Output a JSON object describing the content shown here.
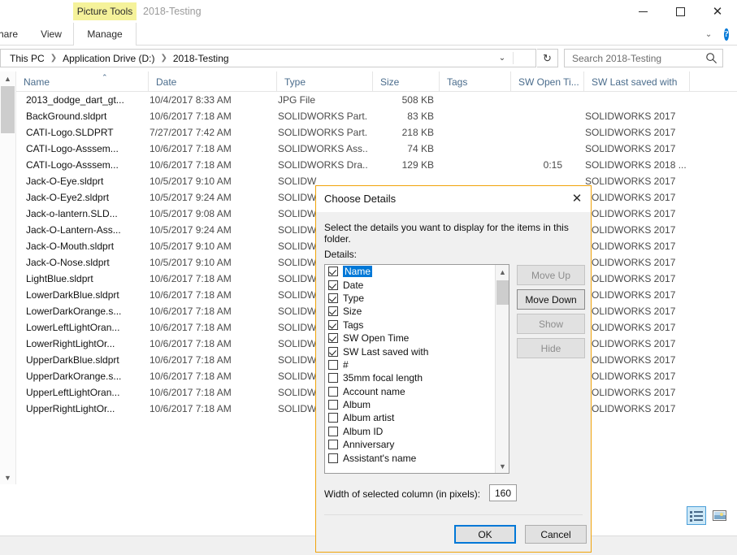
{
  "window": {
    "context_tab": "Picture Tools",
    "title": "2018-Testing",
    "minimize_label": "—",
    "maximize_label": "",
    "close_label": "✕"
  },
  "ribbon": {
    "tabs": [
      {
        "label": "hare"
      },
      {
        "label": "View"
      },
      {
        "label": "Manage"
      }
    ],
    "collapse_label": "⌄",
    "help_label": "?"
  },
  "address": {
    "breadcrumbs": [
      "This PC",
      "Application Drive (D:)",
      "2018-Testing"
    ],
    "separator": "❯",
    "dropdown_label": "⌄",
    "refresh_label": "↻"
  },
  "search": {
    "placeholder": "Search 2018-Testing",
    "value": "",
    "icon": "search-icon"
  },
  "columns": [
    {
      "label": "Name",
      "sorted": true,
      "sort_caret": "⌃"
    },
    {
      "label": "Date"
    },
    {
      "label": "Type"
    },
    {
      "label": "Size"
    },
    {
      "label": "Tags"
    },
    {
      "label": "SW Open Ti..."
    },
    {
      "label": "SW Last saved with"
    }
  ],
  "files": [
    {
      "icon": "jpg-file-icon",
      "name": "2013_dodge_dart_gt...",
      "date": "10/4/2017 8:33 AM",
      "type": "JPG File",
      "size": "508 KB",
      "tags": "",
      "sw_open_time": "",
      "sw_last_saved": ""
    },
    {
      "icon": "solidworks-part-icon",
      "name": "BackGround.sldprt",
      "date": "10/6/2017 7:18 AM",
      "type": "SOLIDWORKS Part...",
      "size": "83 KB",
      "tags": "",
      "sw_open_time": "",
      "sw_last_saved": "SOLIDWORKS 2017"
    },
    {
      "icon": "solidworks-part-icon",
      "name": "CATI-Logo.SLDPRT",
      "date": "7/27/2017 7:42 AM",
      "type": "SOLIDWORKS Part...",
      "size": "218 KB",
      "tags": "",
      "sw_open_time": "",
      "sw_last_saved": "SOLIDWORKS 2017"
    },
    {
      "icon": "dark-sliver-icon",
      "name": "CATI-Logo-Asssem...",
      "date": "10/6/2017 7:18 AM",
      "type": "SOLIDWORKS Ass...",
      "size": "74 KB",
      "tags": "",
      "sw_open_time": "",
      "sw_last_saved": "SOLIDWORKS 2017"
    },
    {
      "icon": "solidworks-drawing-icon",
      "name": "CATI-Logo-Asssem...",
      "date": "10/6/2017 7:18 AM",
      "type": "SOLIDWORKS Dra...",
      "size": "129 KB",
      "tags": "",
      "sw_open_time": "0:15",
      "sw_last_saved": "SOLIDWORKS 2018 ..."
    },
    {
      "icon": "solidworks-part-icon",
      "name": "Jack-O-Eye.sldprt",
      "date": "10/5/2017 9:10 AM",
      "type": "SOLIDW",
      "size": "",
      "tags": "",
      "sw_open_time": "",
      "sw_last_saved": "SOLIDWORKS 2017"
    },
    {
      "icon": "solidworks-part-icon",
      "name": "Jack-O-Eye2.sldprt",
      "date": "10/5/2017 9:24 AM",
      "type": "SOLIDW",
      "size": "",
      "tags": "",
      "sw_open_time": "",
      "sw_last_saved": "SOLIDWORKS 2017"
    },
    {
      "icon": "solidworks-part-icon",
      "name": "Jack-o-lantern.SLD...",
      "date": "10/5/2017 9:08 AM",
      "type": "SOLIDW",
      "size": "",
      "tags": "",
      "sw_open_time": "",
      "sw_last_saved": "SOLIDWORKS 2017"
    },
    {
      "icon": "solidworks-assembly-icon",
      "name": "Jack-O-Lantern-Ass...",
      "date": "10/5/2017 9:24 AM",
      "type": "SOLIDW",
      "size": "",
      "tags": "",
      "sw_open_time": "",
      "sw_last_saved": "SOLIDWORKS 2017"
    },
    {
      "icon": "solidworks-part-icon",
      "name": "Jack-O-Mouth.sldprt",
      "date": "10/5/2017 9:10 AM",
      "type": "SOLIDW",
      "size": "",
      "tags": "",
      "sw_open_time": "",
      "sw_last_saved": "SOLIDWORKS 2017"
    },
    {
      "icon": "solidworks-part-icon",
      "name": "Jack-O-Nose.sldprt",
      "date": "10/5/2017 9:10 AM",
      "type": "SOLIDW",
      "size": "",
      "tags": "",
      "sw_open_time": "",
      "sw_last_saved": "SOLIDWORKS 2017"
    },
    {
      "icon": "solidworks-part-icon",
      "name": "LightBlue.sldprt",
      "date": "10/6/2017 7:18 AM",
      "type": "SOLIDW",
      "size": "",
      "tags": "",
      "sw_open_time": "",
      "sw_last_saved": "SOLIDWORKS 2017"
    },
    {
      "icon": "solidworks-part-icon",
      "name": "LowerDarkBlue.sldprt",
      "date": "10/6/2017 7:18 AM",
      "type": "SOLIDW",
      "size": "",
      "tags": "",
      "sw_open_time": "",
      "sw_last_saved": "SOLIDWORKS 2017"
    },
    {
      "icon": "solidworks-part-icon",
      "name": "LowerDarkOrange.s...",
      "date": "10/6/2017 7:18 AM",
      "type": "SOLIDW",
      "size": "",
      "tags": "",
      "sw_open_time": "",
      "sw_last_saved": "SOLIDWORKS 2017"
    },
    {
      "icon": "solidworks-part-icon",
      "name": "LowerLeftLightOran...",
      "date": "10/6/2017 7:18 AM",
      "type": "SOLIDW",
      "size": "",
      "tags": "",
      "sw_open_time": "",
      "sw_last_saved": "SOLIDWORKS 2017"
    },
    {
      "icon": "solidworks-part-icon",
      "name": "LowerRightLightOr...",
      "date": "10/6/2017 7:18 AM",
      "type": "SOLIDW",
      "size": "",
      "tags": "",
      "sw_open_time": "",
      "sw_last_saved": "SOLIDWORKS 2017"
    },
    {
      "icon": "solidworks-part-icon",
      "name": "UpperDarkBlue.sldprt",
      "date": "10/6/2017 7:18 AM",
      "type": "SOLIDW",
      "size": "",
      "tags": "",
      "sw_open_time": "",
      "sw_last_saved": "SOLIDWORKS 2017"
    },
    {
      "icon": "solidworks-part-icon",
      "name": "UpperDarkOrange.s...",
      "date": "10/6/2017 7:18 AM",
      "type": "SOLIDW",
      "size": "",
      "tags": "",
      "sw_open_time": "",
      "sw_last_saved": "SOLIDWORKS 2017"
    },
    {
      "icon": "solidworks-part-icon",
      "name": "UpperLeftLightOran...",
      "date": "10/6/2017 7:18 AM",
      "type": "SOLIDW",
      "size": "",
      "tags": "",
      "sw_open_time": "",
      "sw_last_saved": "SOLIDWORKS 2017"
    },
    {
      "icon": "solidworks-part-icon",
      "name": "UpperRightLightOr...",
      "date": "10/6/2017 7:18 AM",
      "type": "SOLIDW",
      "size": "",
      "tags": "",
      "sw_open_time": "",
      "sw_last_saved": "SOLIDWORKS 2017"
    }
  ],
  "view_buttons": {
    "details_label": "",
    "large_icons_label": ""
  },
  "dialog": {
    "title": "Choose Details",
    "close_label": "✕",
    "description": "Select the details you want to display for the items in this folder.",
    "details_label": "Details:",
    "items": [
      {
        "label": "Name",
        "checked": true,
        "selected": true
      },
      {
        "label": "Date",
        "checked": true,
        "selected": false
      },
      {
        "label": "Type",
        "checked": true,
        "selected": false
      },
      {
        "label": "Size",
        "checked": true,
        "selected": false
      },
      {
        "label": "Tags",
        "checked": true,
        "selected": false
      },
      {
        "label": "SW Open Time",
        "checked": true,
        "selected": false
      },
      {
        "label": "SW Last saved with",
        "checked": true,
        "selected": false
      },
      {
        "label": "#",
        "checked": false,
        "selected": false
      },
      {
        "label": "35mm focal length",
        "checked": false,
        "selected": false
      },
      {
        "label": "Account name",
        "checked": false,
        "selected": false
      },
      {
        "label": "Album",
        "checked": false,
        "selected": false
      },
      {
        "label": "Album artist",
        "checked": false,
        "selected": false
      },
      {
        "label": "Album ID",
        "checked": false,
        "selected": false
      },
      {
        "label": "Anniversary",
        "checked": false,
        "selected": false
      },
      {
        "label": "Assistant's name",
        "checked": false,
        "selected": false
      }
    ],
    "buttons": {
      "move_up": "Move Up",
      "move_down": "Move Down",
      "show": "Show",
      "hide": "Hide",
      "ok": "OK",
      "cancel": "Cancel"
    },
    "width_label": "Width of selected column (in pixels):",
    "width_value": "160",
    "scroll_up": "⌃",
    "scroll_down": "⌄"
  },
  "colors": {
    "accent": "#0078d7",
    "context_tab": "#f5f29a",
    "dialog_border": "#f0a30a",
    "column_header_text": "#4a6c8c"
  }
}
